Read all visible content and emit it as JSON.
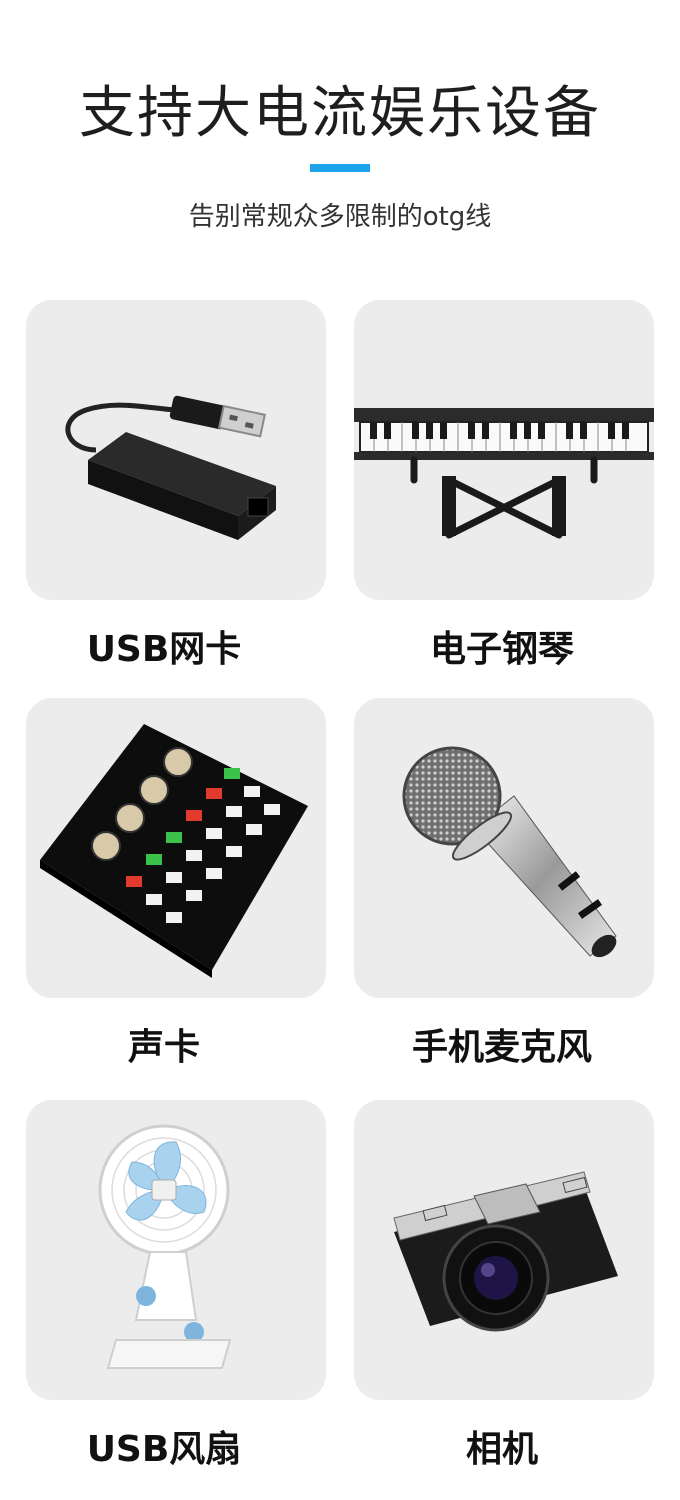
{
  "header": {
    "title": "支持大电流娱乐设备",
    "subtitle": "告别常规众多限制的otg线",
    "accent_color": "#1aa3e8"
  },
  "items": [
    {
      "label": "USB网卡",
      "icon": "usb-ethernet-adapter-icon"
    },
    {
      "label": "电子钢琴",
      "icon": "electronic-piano-icon"
    },
    {
      "label": "声卡",
      "icon": "sound-card-icon"
    },
    {
      "label": "手机麦克风",
      "icon": "microphone-icon"
    },
    {
      "label": "USB风扇",
      "icon": "usb-fan-icon"
    },
    {
      "label": "相机",
      "icon": "camera-icon"
    }
  ]
}
